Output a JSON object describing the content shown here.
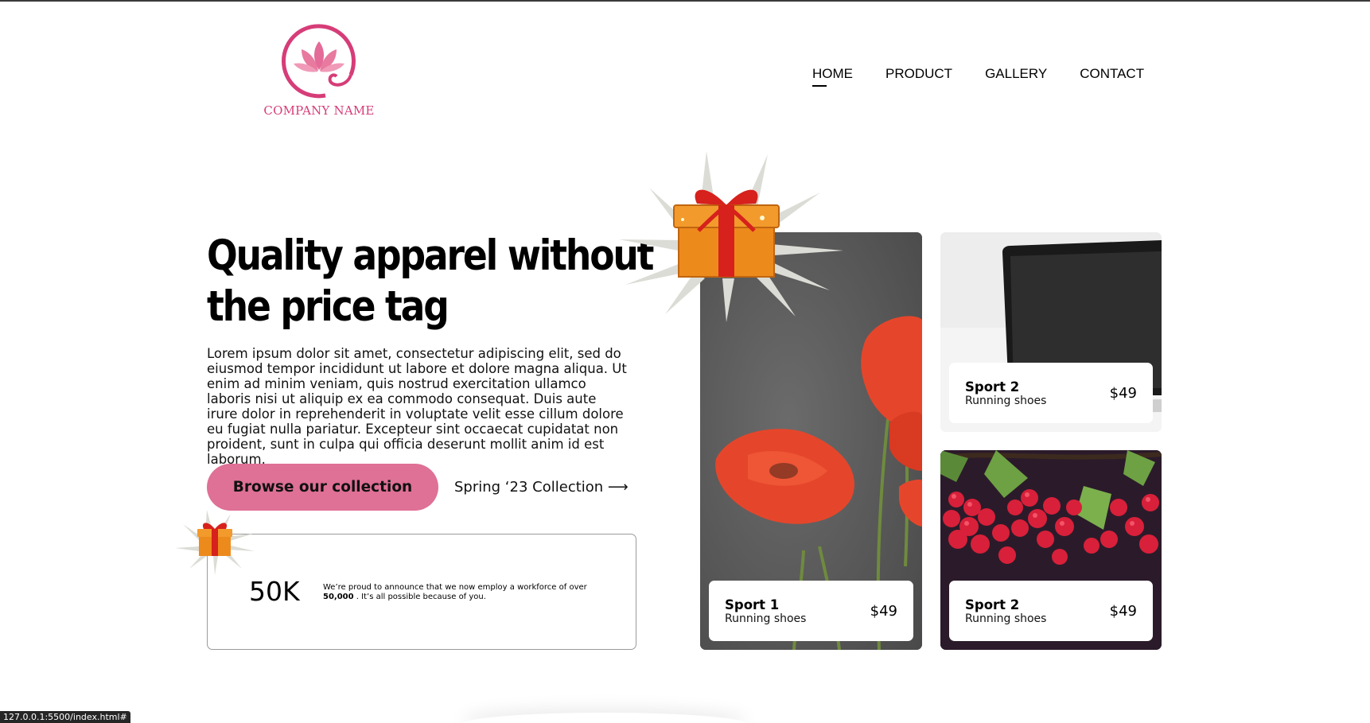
{
  "logo": {
    "text": "COMPANY NAME",
    "brand_color": "#d63d78",
    "icon": "lotus-icon"
  },
  "nav": {
    "items": [
      "HOME",
      "PRODUCT",
      "GALLERY",
      "CONTACT"
    ],
    "active": "HOME"
  },
  "hero": {
    "title_line1": "Quality apparel without",
    "title_line2": "the price tag",
    "body": "Lorem ipsum dolor sit amet, consectetur adipiscing elit, sed do eiusmod tempor incididunt ut labore et dolore magna aliqua. Ut enim ad minim veniam, quis nostrud exercitation ullamco laboris nisi ut aliquip ex ea commodo consequat. Duis aute irure dolor in reprehenderit in voluptate velit esse cillum dolore eu fugiat nulla pariatur. Excepteur sint occaecat cupidatat non proident, sunt in culpa qui officia deserunt mollit anim id est laborum.",
    "cta_label": "Browse our collection",
    "cta_color": "#df7096",
    "secondary_link": "Spring ‘23 Collection ⟶"
  },
  "stats": {
    "number": "50K",
    "text_before": "We’re proud to announce that we now employ a workforce of over",
    "text_bold": "50,000",
    "text_after": ". It’s all possible because of you."
  },
  "products": [
    {
      "name": "Sport 1",
      "subtitle": "Running shoes",
      "price": "$49",
      "image": "poppy-flowers-image"
    },
    {
      "name": "Sport 2",
      "subtitle": "Running shoes",
      "price": "$49",
      "image": "laptop-image"
    },
    {
      "name": "Sport 2",
      "subtitle": "Running shoes",
      "price": "$49",
      "image": "red-currants-image"
    }
  ],
  "status_bar": {
    "url": "127.0.0.1:5500/index.html#"
  }
}
